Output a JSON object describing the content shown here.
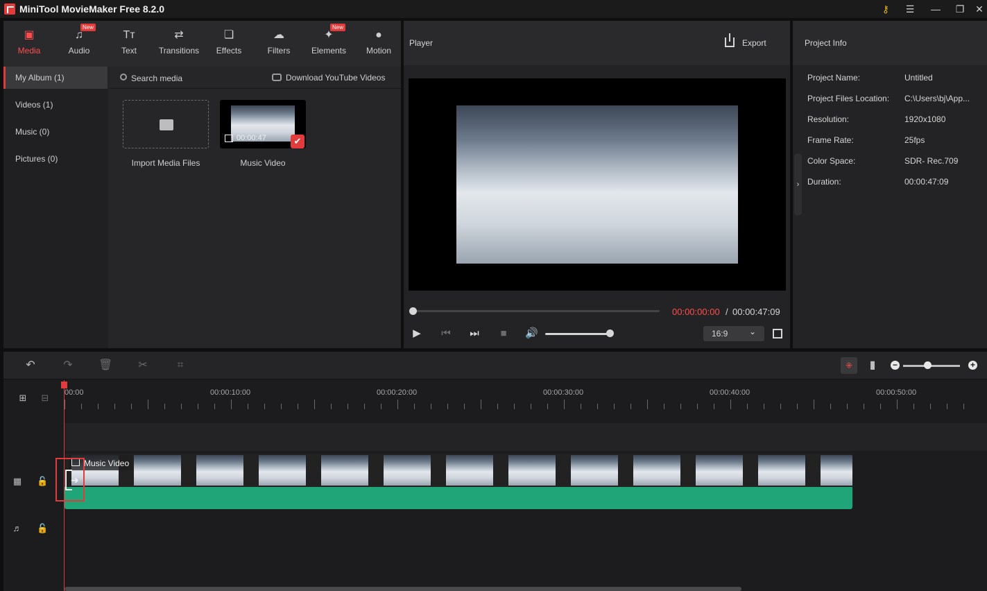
{
  "app": {
    "title": "MiniTool MovieMaker Free 8.2.0"
  },
  "toolbar": {
    "tabs": [
      {
        "label": "Media",
        "icon": "media-icon",
        "active": true
      },
      {
        "label": "Audio",
        "icon": "music-note-icon",
        "badge": "New"
      },
      {
        "label": "Text",
        "icon": "text-icon"
      },
      {
        "label": "Transitions",
        "icon": "transitions-icon"
      },
      {
        "label": "Effects",
        "icon": "effects-icon"
      },
      {
        "label": "Filters",
        "icon": "filters-icon"
      },
      {
        "label": "Elements",
        "icon": "elements-icon",
        "badge": "New"
      },
      {
        "label": "Motion",
        "icon": "motion-icon"
      }
    ]
  },
  "album": {
    "items": [
      {
        "label": "My Album (1)",
        "active": true
      },
      {
        "label": "Videos (1)"
      },
      {
        "label": "Music (0)"
      },
      {
        "label": "Pictures (0)"
      }
    ]
  },
  "media": {
    "search_placeholder": "Search media",
    "youtube_label": "Download YouTube Videos",
    "import_label": "Import Media Files",
    "clip": {
      "duration": "00:00:47",
      "label": "Music Video"
    }
  },
  "player": {
    "title": "Player",
    "export_label": "Export",
    "time_current": "00:00:00:00",
    "time_separator": "/",
    "time_total": "00:00:47:09",
    "aspect_ratio": "16:9",
    "progress": 0,
    "volume": 1
  },
  "project_info": {
    "title": "Project Info",
    "rows": [
      {
        "key": "Project Name:",
        "value": "Untitled"
      },
      {
        "key": "Project Files Location:",
        "value": "C:\\Users\\bj\\App..."
      },
      {
        "key": "Resolution:",
        "value": "1920x1080"
      },
      {
        "key": "Frame Rate:",
        "value": "25fps"
      },
      {
        "key": "Color Space:",
        "value": "SDR- Rec.709"
      },
      {
        "key": "Duration:",
        "value": "00:00:47:09"
      }
    ]
  },
  "timeline": {
    "ruler_labels": [
      "00:00",
      "00:00:10:00",
      "00:00:20:00",
      "00:00:30:00",
      "00:00:40:00",
      "00:00:50:00"
    ],
    "clip_title": "Music Video"
  },
  "colors": {
    "accent": "#e23b3b",
    "waveform": "#1fa577",
    "panel": "#232325"
  }
}
